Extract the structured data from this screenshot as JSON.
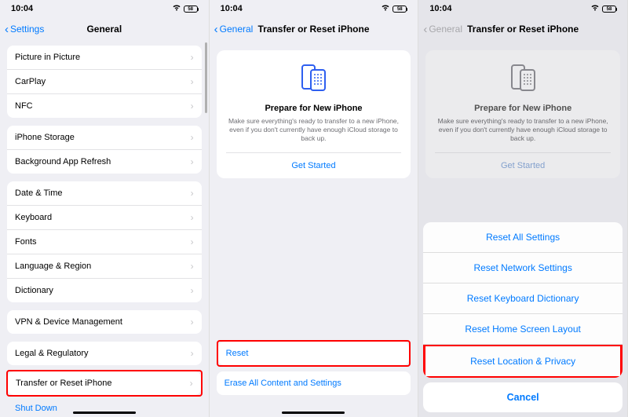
{
  "status": {
    "time": "10:04",
    "battery_label": "58"
  },
  "screen1": {
    "back_label": "Settings",
    "title": "General",
    "groups": [
      [
        "Picture in Picture",
        "CarPlay",
        "NFC"
      ],
      [
        "iPhone Storage",
        "Background App Refresh"
      ],
      [
        "Date & Time",
        "Keyboard",
        "Fonts",
        "Language & Region",
        "Dictionary"
      ],
      [
        "VPN & Device Management"
      ],
      [
        "Legal & Regulatory"
      ]
    ],
    "transfer_label": "Transfer or Reset iPhone",
    "shutdown_label": "Shut Down"
  },
  "screen2": {
    "back_label": "General",
    "title": "Transfer or Reset iPhone",
    "card": {
      "heading": "Prepare for New iPhone",
      "body": "Make sure everything's ready to transfer to a new iPhone, even if you don't currently have enough iCloud storage to back up.",
      "button": "Get Started"
    },
    "reset_label": "Reset",
    "erase_label": "Erase All Content and Settings"
  },
  "screen3": {
    "back_label": "General",
    "title": "Transfer or Reset iPhone",
    "card": {
      "heading": "Prepare for New iPhone",
      "body": "Make sure everything's ready to transfer to a new iPhone, even if you don't currently have enough iCloud storage to back up.",
      "button": "Get Started"
    },
    "sheet": {
      "items": [
        "Reset All Settings",
        "Reset Network Settings",
        "Reset Keyboard Dictionary",
        "Reset Home Screen Layout",
        "Reset Location & Privacy"
      ],
      "cancel": "Cancel"
    }
  }
}
